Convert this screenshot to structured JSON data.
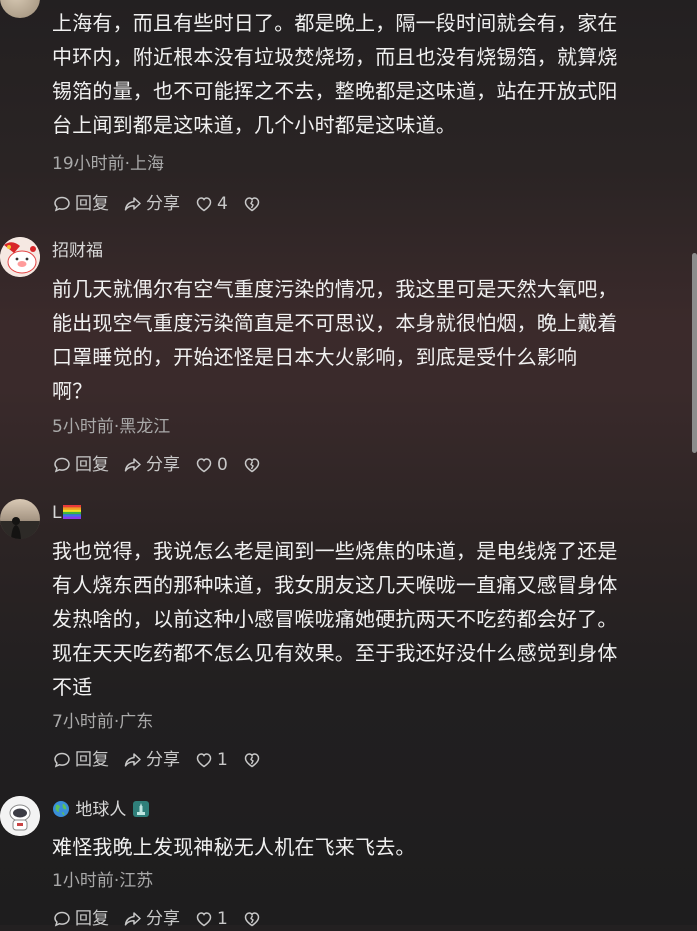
{
  "comments": [
    {
      "username": "",
      "lines": [
        "上海有，而且有些时日了。都是晚上，隔一段时间就会有，家在",
        "中环内，附近根本没有垃圾焚烧场，而且也没有烧锡箔，就算烧",
        "锡箔的量，也不可能挥之不去，整晚都是这味道，站在开放式阳",
        "台上闻到都是这味道，几个小时都是这味道。"
      ],
      "meta": "19小时前·上海",
      "reply": "回复",
      "share": "分享",
      "likes": "4"
    },
    {
      "username": "招财福",
      "lines": [
        "前几天就偶尔有空气重度污染的情况，我这里可是天然大氧吧，",
        "能出现空气重度污染简直是不可思议，本身就很怕烟，晚上戴着",
        "口罩睡觉的，开始还怪是日本大火影响，到底是受什么影响",
        "啊？"
      ],
      "meta": "5小时前·黑龙江",
      "reply": "回复",
      "share": "分享",
      "likes": "0"
    },
    {
      "username": "L",
      "lines": [
        "我也觉得，我说怎么老是闻到一些烧焦的味道，是电线烧了还是",
        "有人烧东西的那种味道，我女朋友这几天喉咙一直痛又感冒身体",
        "发热啥的，以前这种小感冒喉咙痛她硬抗两天不吃药都会好了。",
        "现在天天吃药都不怎么见有效果。至于我还好没什么感觉到身体",
        "不适"
      ],
      "meta": "7小时前·广东",
      "reply": "回复",
      "share": "分享",
      "likes": "1"
    },
    {
      "username": "地球人",
      "lines": [
        "难怪我晚上发现神秘无人机在飞来飞去。"
      ],
      "meta": "1小时前·江苏",
      "reply": "回复",
      "share": "分享",
      "likes": "1"
    }
  ],
  "icons": {
    "reply": "reply-bubble-icon",
    "share": "share-arrow-icon",
    "like": "heart-icon",
    "dislike": "broken-heart-icon"
  }
}
